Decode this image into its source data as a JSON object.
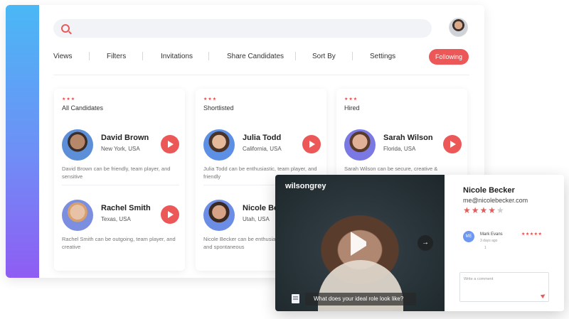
{
  "search": {
    "placeholder": ""
  },
  "nav": {
    "items": [
      "Views",
      "Filters",
      "Invitations",
      "Share Candidates",
      "Sort By",
      "Settings"
    ],
    "following_label": "Following"
  },
  "columns": [
    {
      "rating": "★★★",
      "title": "All Candidates",
      "candidates": [
        {
          "name": "David Brown",
          "location": "New York, USA",
          "description": "David Brown can be friendly, team player, and sensitive"
        },
        {
          "name": "Rachel Smith",
          "location": "Texas, USA",
          "description": "Rachel Smith can be outgoing, team player, and creative"
        }
      ]
    },
    {
      "rating": "★★★",
      "title": "Shortlisted",
      "candidates": [
        {
          "name": "Julia Todd",
          "location": "California, USA",
          "description": "Julia Todd can be enthusiastic, team player, and friendly"
        },
        {
          "name": "Nicole Becker",
          "location": "Utah, USA",
          "description": "Nicole Becker can be enthusiastic, team player, and spontaneous"
        }
      ]
    },
    {
      "rating": "★★★",
      "title": "Hired",
      "candidates": [
        {
          "name": "Sarah Wilson",
          "location": "Florida, USA",
          "description": "Sarah Wilson can be secure, creative & spontaneous"
        }
      ]
    }
  ],
  "video": {
    "brand": "wilsongrey",
    "caption": "What  does your ideal role look like?"
  },
  "feedback": {
    "name": "Nicole Becker",
    "email": "me@nicolebecker.com",
    "rating": 4,
    "rating_max": 5,
    "comment": {
      "initials": "ME",
      "author": "Mark Evans",
      "time": "3 days ago",
      "stars": "★★★★★",
      "reply_count": "1"
    },
    "comment_placeholder": "Write a comment"
  },
  "colors": {
    "accent": "#ec5757",
    "sidebar_top": "#4ab8f5",
    "sidebar_bottom": "#8f5cf3"
  }
}
